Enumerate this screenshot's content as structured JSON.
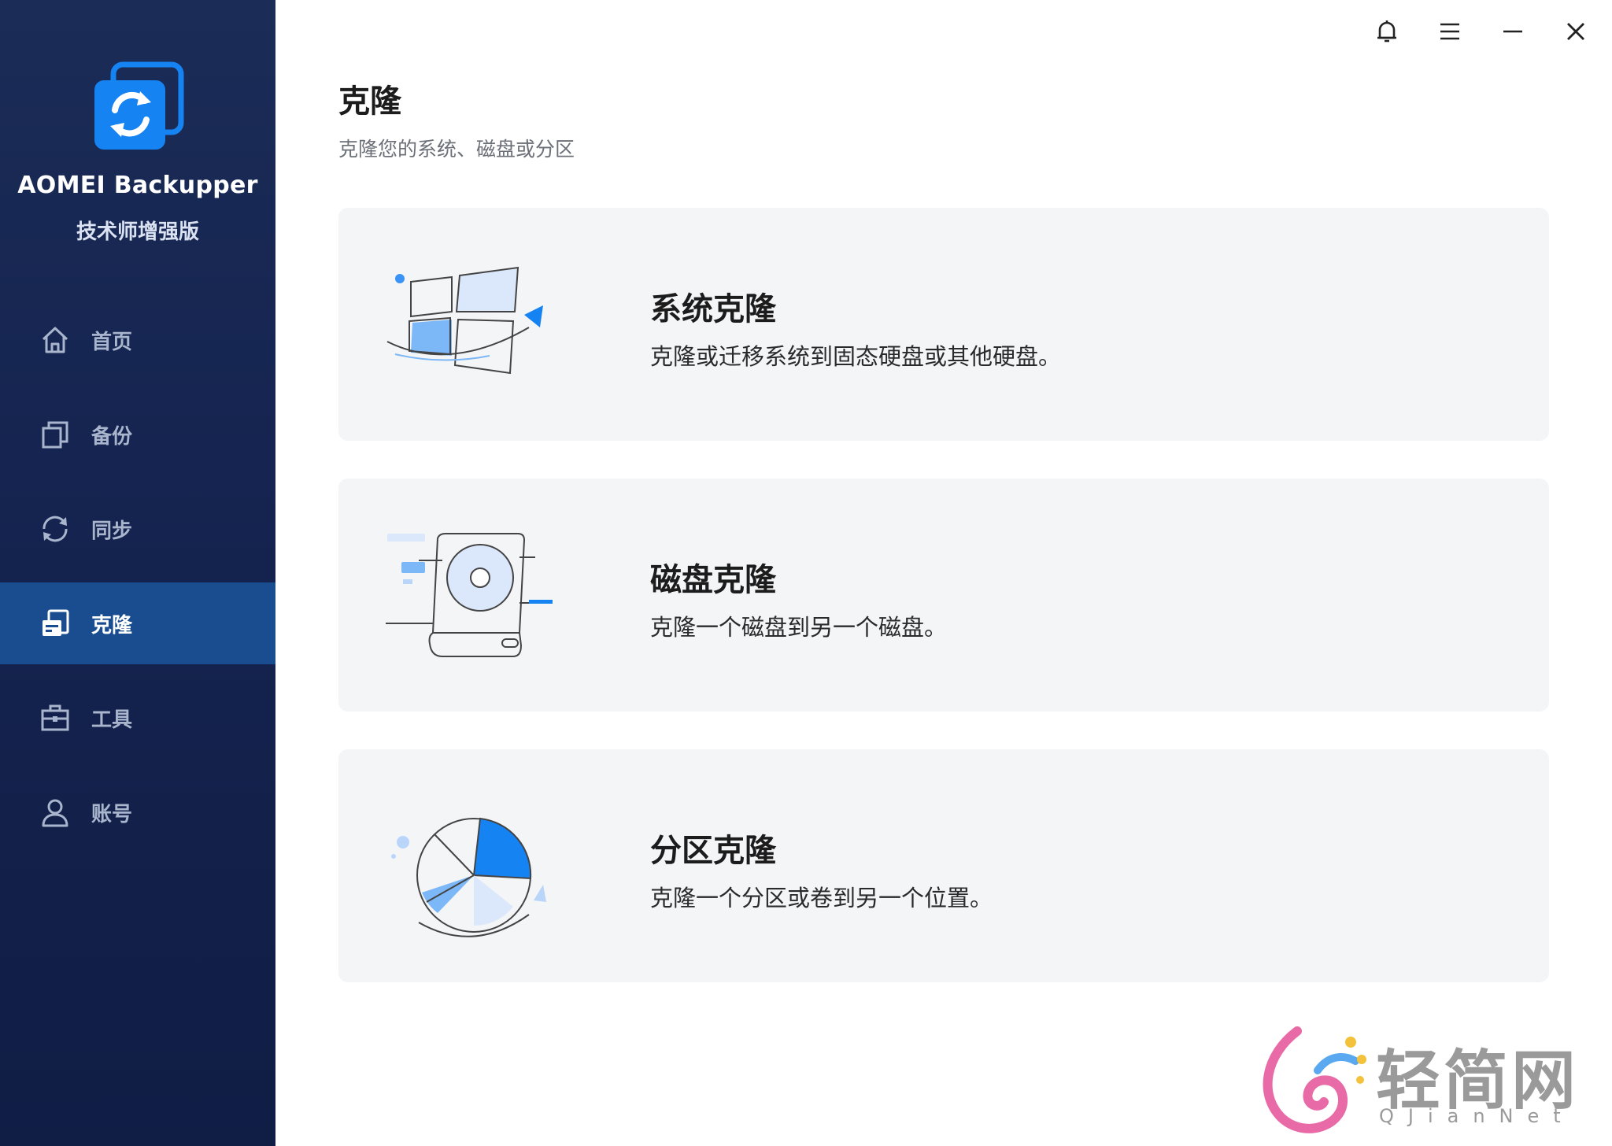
{
  "app": {
    "name": "AOMEI Backupper",
    "edition": "技术师增强版"
  },
  "sidebar": {
    "items": [
      {
        "label": "首页",
        "icon": "home-icon",
        "active": false
      },
      {
        "label": "备份",
        "icon": "backup-icon",
        "active": false
      },
      {
        "label": "同步",
        "icon": "sync-icon",
        "active": false
      },
      {
        "label": "克隆",
        "icon": "clone-icon",
        "active": true
      },
      {
        "label": "工具",
        "icon": "toolbox-icon",
        "active": false
      },
      {
        "label": "账号",
        "icon": "user-icon",
        "active": false
      }
    ]
  },
  "window_controls": [
    "bell-icon",
    "menu-icon",
    "minimize-icon",
    "close-icon"
  ],
  "main": {
    "title": "克隆",
    "subtitle": "克隆您的系统、磁盘或分区",
    "cards": [
      {
        "title": "系统克隆",
        "desc": "克隆或迁移系统到固态硬盘或其他硬盘。",
        "icon": "system-clone-illustration"
      },
      {
        "title": "磁盘克隆",
        "desc": "克隆一个磁盘到另一个磁盘。",
        "icon": "disk-clone-illustration"
      },
      {
        "title": "分区克隆",
        "desc": "克隆一个分区或卷到另一个位置。",
        "icon": "partition-clone-illustration"
      }
    ]
  },
  "watermark": {
    "text": "轻简网",
    "sub": "QJianNet"
  },
  "colors": {
    "sidebar_bg": "#152450",
    "active_nav": "#1a4d8f",
    "accent_blue": "#1683f3",
    "card_bg": "#f4f5f7"
  }
}
